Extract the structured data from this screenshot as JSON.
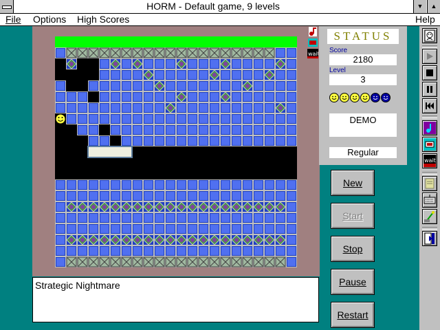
{
  "window": {
    "title": "HORM - Default game, 9 levels"
  },
  "menu": {
    "file": "File",
    "options": "Options",
    "high_scores": "High Scores",
    "help": "Help"
  },
  "status": {
    "title": "STATUS",
    "score_label": "Score",
    "score": "2180",
    "level_label": "Level",
    "level": "3",
    "lives_total": 6,
    "lives_remaining": 4,
    "mode_text": "DEMO",
    "difficulty": "Regular"
  },
  "buttons": {
    "new": "New",
    "start": "Start",
    "stop": "Stop",
    "pause": "Pause",
    "restart": "Restart"
  },
  "message": "Strategic Nightmare",
  "side_icons": [
    "music-note-icon",
    "sound-icon",
    "wait-icon"
  ],
  "toolbar_icons": [
    "face-icon",
    "play-icon",
    "stop-square-icon",
    "pause-icon",
    "rewind-icon",
    "music-note-icon",
    "sound-icon",
    "wait-icon",
    "document-icon",
    "keyboard-icon",
    "joystick-icon",
    "exit-door-icon"
  ],
  "colors": {
    "teal_background": "#008080",
    "block_blue": "#4060e0",
    "diamond_green": "#40a040",
    "top_wall": "#00ff00",
    "bottom_wall": "#ff0000",
    "status_title": "#808000"
  }
}
